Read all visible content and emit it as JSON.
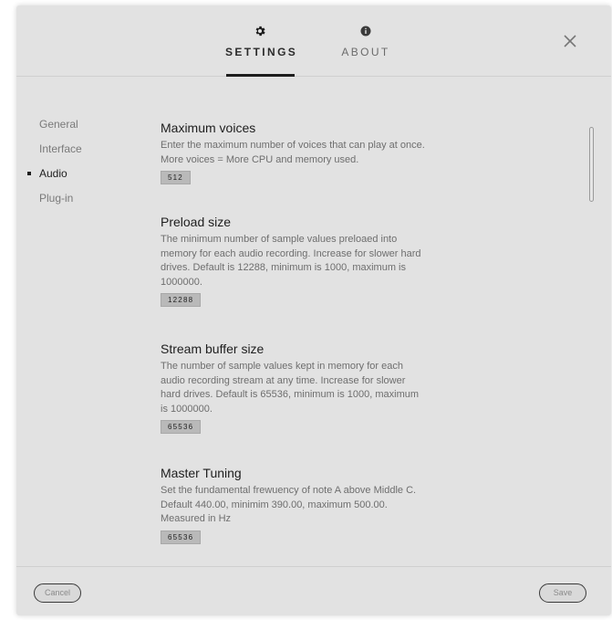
{
  "header": {
    "tabs": [
      {
        "label": "SETTINGS",
        "icon": "gear-icon",
        "active": true
      },
      {
        "label": "ABOUT",
        "icon": "info-icon",
        "active": false
      }
    ],
    "close_icon": "close-icon"
  },
  "sidebar": {
    "items": [
      {
        "label": "General",
        "active": false
      },
      {
        "label": "Interface",
        "active": false
      },
      {
        "label": "Audio",
        "active": true
      },
      {
        "label": "Plug-in",
        "active": false
      }
    ]
  },
  "main": {
    "sections": [
      {
        "title": "Maximum voices",
        "description": "Enter the maximum number of voices that can play at once. More voices = More CPU and memory used.",
        "value": "512"
      },
      {
        "title": "Preload size",
        "description": "The minimum number of sample values preloaed into memory for each audio recording. Increase for slower hard drives. Default is 12288, minimum is 1000, maximum is 1000000.",
        "value": "12288"
      },
      {
        "title": "Stream buffer size",
        "description": "The number of sample values kept in memory for each audio recording stream at any time. Increase for slower hard drives. Default is 65536, minimum is 1000, maximum is 1000000.",
        "value": "65536"
      },
      {
        "title": "Master Tuning",
        "description": "Set the fundamental frewuency of note A above Middle C. Default 440.00, minimim 390.00, maximum 500.00. Measured in Hz",
        "value": "65536"
      }
    ]
  },
  "footer": {
    "cancel_label": "Cancel",
    "save_label": "Save"
  },
  "colors": {
    "dialog_bg": "#e2e2e2",
    "accent": "#1e1e1e",
    "value_box": "#b9b9b9"
  }
}
